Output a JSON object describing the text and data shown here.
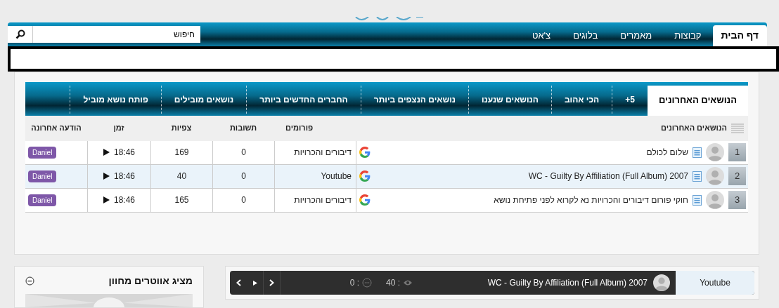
{
  "nav": {
    "tabs": [
      {
        "label": "דף הבית",
        "selected": true
      },
      {
        "label": "קבוצות",
        "selected": false
      },
      {
        "label": "מאמרים",
        "selected": false
      },
      {
        "label": "בלוגים",
        "selected": false
      },
      {
        "label": "צ'אט",
        "selected": false
      }
    ],
    "search": {
      "value": "חיפוש"
    }
  },
  "topics": {
    "tabs": [
      {
        "label": "הנושאים האחרונים",
        "selected": true
      },
      {
        "label": "5+",
        "selected": false
      },
      {
        "label": "הכי אהוב",
        "selected": false
      },
      {
        "label": "הנושאים שנענו",
        "selected": false
      },
      {
        "label": "נושאים הנצפים ביותר",
        "selected": false
      },
      {
        "label": "החברים החדשים ביותר",
        "selected": false
      },
      {
        "label": "נושאים מובילים",
        "selected": false
      },
      {
        "label": "פותח נושא מוביל",
        "selected": false
      }
    ],
    "columns": [
      "הנושאים האחרונים",
      "פורומים",
      "תשובות",
      "צפיות",
      "זמן",
      "הודעה אחרונה"
    ],
    "rows": [
      {
        "rank": "1",
        "title": "שלום לכולם",
        "forum": "דיבורים והכרויות",
        "replies": "0",
        "views": "169",
        "time": "18:46",
        "user": "Daniel"
      },
      {
        "rank": "2",
        "title": "WC - Guilty By Affiliation (Full Album) 2007",
        "forum": "Youtube",
        "replies": "0",
        "views": "40",
        "time": "18:46",
        "user": "Daniel"
      },
      {
        "rank": "3",
        "title": "חוקי פורום דיבורים והכרויות נא לקרוא לפני פתיחת נושא",
        "forum": "דיבורים והכרויות",
        "replies": "0",
        "views": "165",
        "time": "18:46",
        "user": "Daniel"
      }
    ]
  },
  "ticker": {
    "forum": "Youtube",
    "title": "WC - Guilty By Affiliation (Full Album) 2007",
    "views": ": 40",
    "replies": ": 0"
  },
  "avatar_panel": {
    "title": "מציג אווטרים מחוון"
  }
}
